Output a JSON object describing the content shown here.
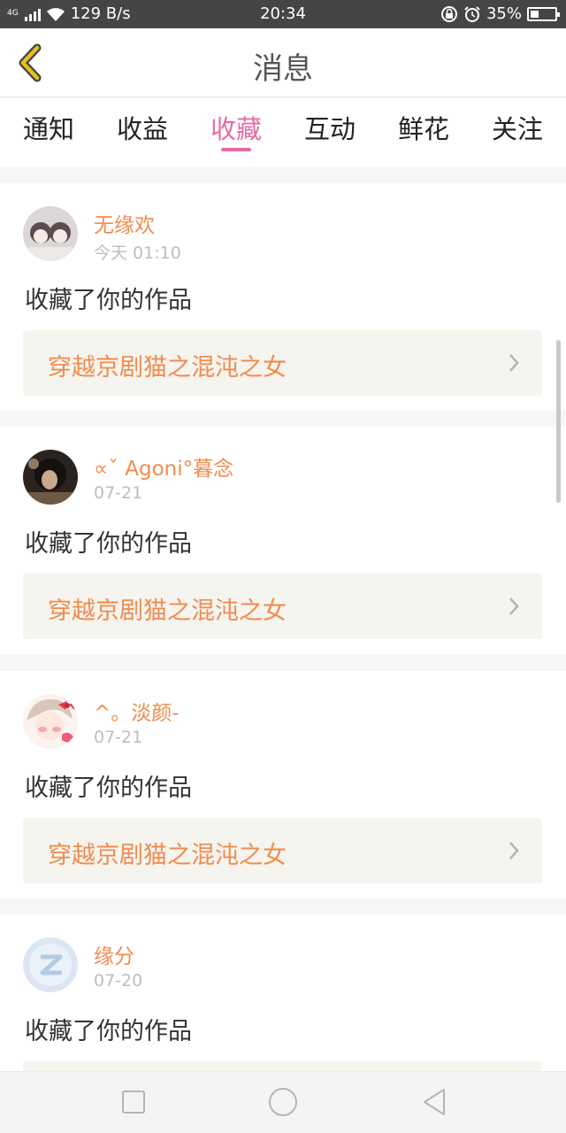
{
  "status_bar": {
    "network_type": "4G",
    "speed": "129 B/s",
    "time": "20:34",
    "battery_percent": "35%",
    "battery_level": 0.35
  },
  "header": {
    "title": "消息",
    "back_icon": "chevron-left-icon",
    "accent_color": "#e6c020"
  },
  "tabs": [
    {
      "label": "通知",
      "active": false
    },
    {
      "label": "收益",
      "active": false
    },
    {
      "label": "收藏",
      "active": true
    },
    {
      "label": "互动",
      "active": false
    },
    {
      "label": "鲜花",
      "active": false
    },
    {
      "label": "关注",
      "active": false
    }
  ],
  "colors": {
    "active_tab": "#e86ba3",
    "username": "#f08c50",
    "work_title": "#f08c50",
    "work_bg": "#f5f4ee"
  },
  "messages": [
    {
      "username": "无缘欢",
      "date": "今天 01:10",
      "action": "收藏了你的作品",
      "work_title": "穿越京剧猫之混沌之女"
    },
    {
      "username": "∝ˇ Agoni°暮念",
      "date": "07-21",
      "action": "收藏了你的作品",
      "work_title": "穿越京剧猫之混沌之女"
    },
    {
      "username": "^。淡颜-",
      "date": "07-21",
      "action": "收藏了你的作品",
      "work_title": "穿越京剧猫之混沌之女"
    },
    {
      "username": "缘分",
      "date": "07-20",
      "action": "收藏了你的作品",
      "work_title": ""
    }
  ],
  "nav_bar": {
    "recent_icon": "square-icon",
    "home_icon": "circle-icon",
    "back_icon": "triangle-back-icon"
  }
}
